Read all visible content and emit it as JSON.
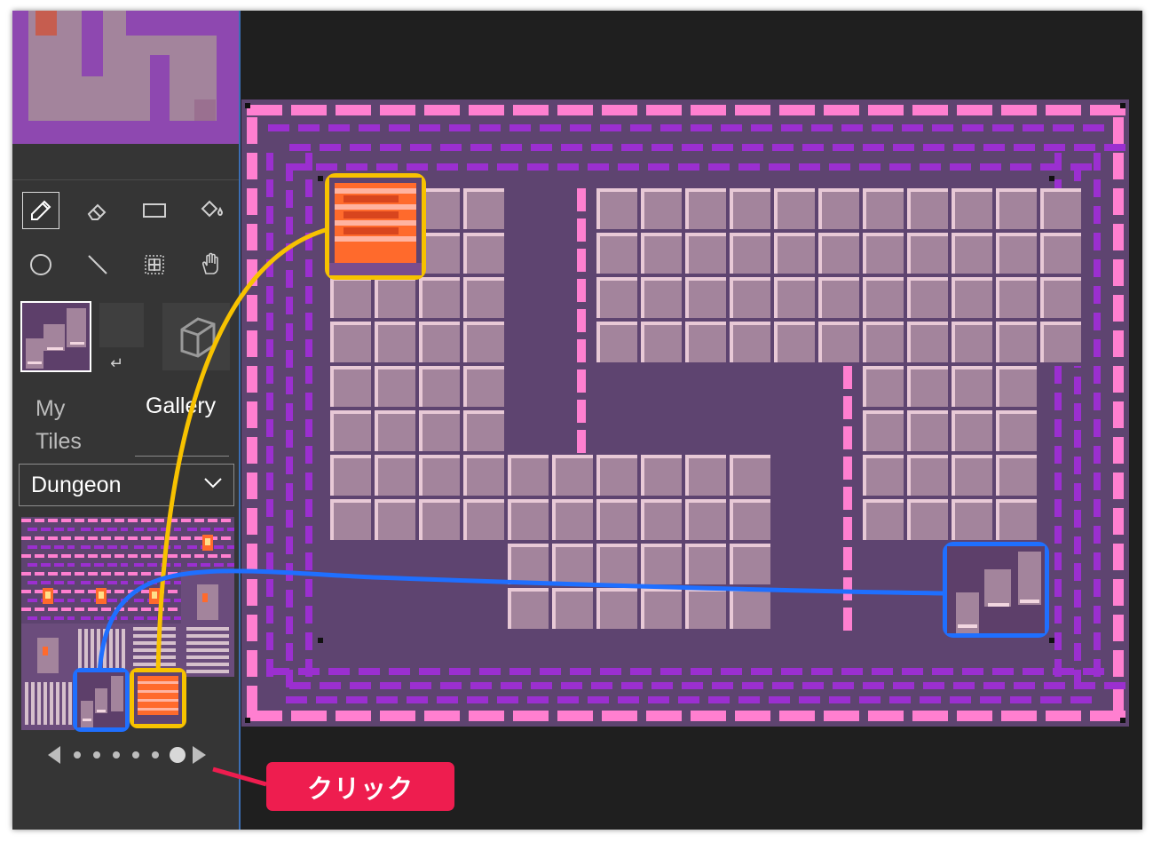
{
  "sidebar": {
    "tools": [
      {
        "name": "pencil-icon",
        "active": true
      },
      {
        "name": "eraser-icon",
        "active": false
      },
      {
        "name": "rectangle-icon",
        "active": false
      },
      {
        "name": "fill-bucket-icon",
        "active": false
      },
      {
        "name": "circle-icon",
        "active": false
      },
      {
        "name": "line-icon",
        "active": false
      },
      {
        "name": "grid-select-icon",
        "active": false
      },
      {
        "name": "hand-icon",
        "active": false
      }
    ],
    "tab_my": "My Tiles",
    "tab_gallery": "Gallery",
    "category": "Dungeon",
    "pager": {
      "current_page": 6,
      "total_pages": 6
    }
  },
  "annotation": {
    "label": "クリック",
    "colors": {
      "yellow": "#f7c200",
      "blue": "#1f6fff",
      "red": "#ee1d4f"
    }
  },
  "palette": {
    "wall_dark": "#5e4470",
    "wall_pink": "#ff7fd0",
    "wall_purple": "#9b2fd0",
    "floor": "#a3849c",
    "floor_line": "#e8c9d6",
    "stairs_orange": "#ff6a2c"
  }
}
